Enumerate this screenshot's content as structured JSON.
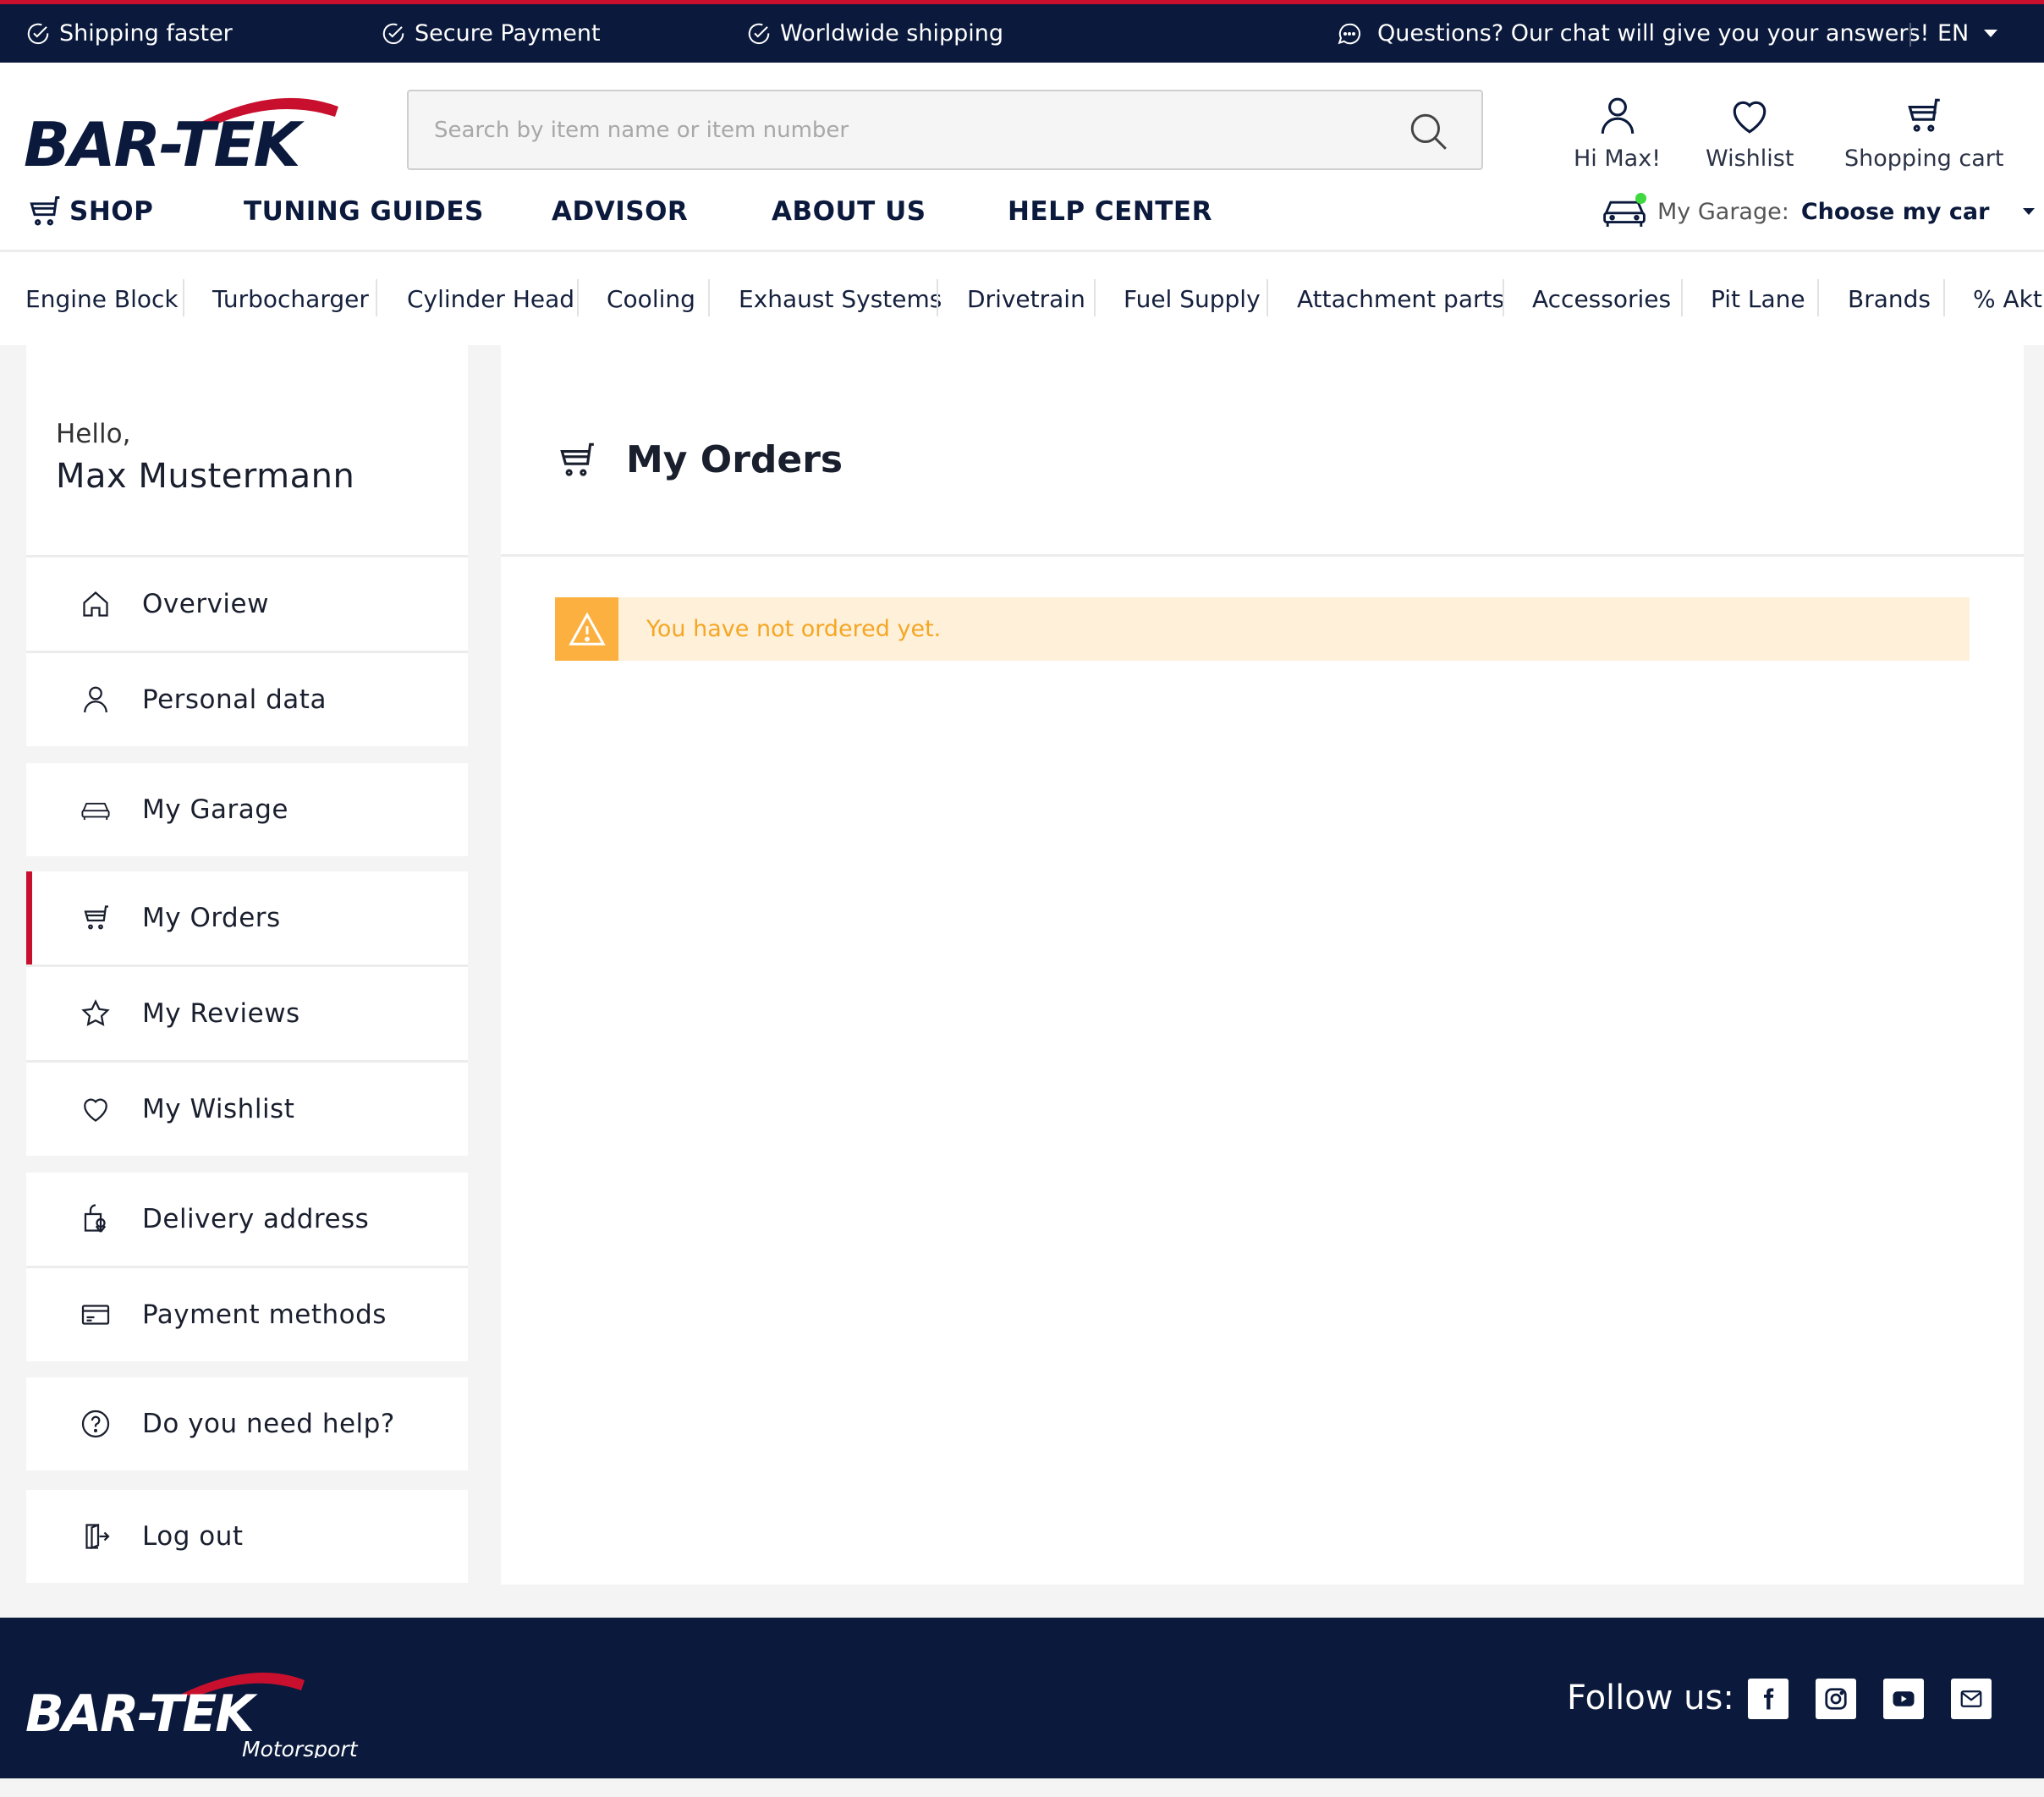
{
  "topbar": {
    "usp": [
      "Shipping faster",
      "Secure Payment",
      "Worldwide shipping"
    ],
    "chat": "Questions? Our chat will give you your answers!",
    "language": "EN"
  },
  "brand": {
    "logo_text": "BAR-TEK",
    "footer_tagline": "Motorsport"
  },
  "header": {
    "search_placeholder": "Search by item name or item number",
    "account_label": "Hi Max!",
    "wishlist_label": "Wishlist",
    "cart_label": "Shopping cart",
    "garage_label": "My Garage:",
    "garage_value": "Choose my car"
  },
  "mainnav": [
    "SHOP",
    "TUNING GUIDES",
    "ADVISOR",
    "ABOUT US",
    "HELP CENTER"
  ],
  "categories": [
    "Engine Block",
    "Turbocharger",
    "Cylinder Head",
    "Cooling",
    "Exhaust Systems",
    "Drivetrain",
    "Fuel Supply",
    "Attachment parts",
    "Accessories",
    "Pit Lane",
    "Brands",
    "% Akti"
  ],
  "sidebar": {
    "greeting": "Hello,",
    "user_name": "Max Mustermann",
    "items": [
      {
        "label": "Overview",
        "icon": "home-icon"
      },
      {
        "label": "Personal data",
        "icon": "user-icon"
      },
      {
        "label": "My Garage",
        "icon": "car-icon"
      },
      {
        "label": "My Orders",
        "icon": "cart-icon",
        "active": true
      },
      {
        "label": "My Reviews",
        "icon": "star-icon"
      },
      {
        "label": "My Wishlist",
        "icon": "heart-icon"
      },
      {
        "label": "Delivery address",
        "icon": "location-icon"
      },
      {
        "label": "Payment methods",
        "icon": "card-icon"
      },
      {
        "label": "Do you need help?",
        "icon": "help-icon"
      },
      {
        "label": "Log out",
        "icon": "logout-icon"
      }
    ]
  },
  "content": {
    "title": "My Orders",
    "alert": "You have not ordered yet."
  },
  "footer": {
    "follow_label": "Follow us:"
  },
  "colors": {
    "navy": "#0b1a3c",
    "red": "#c8102e",
    "warning": "#fbb040",
    "warning_bg": "#fff0da"
  }
}
